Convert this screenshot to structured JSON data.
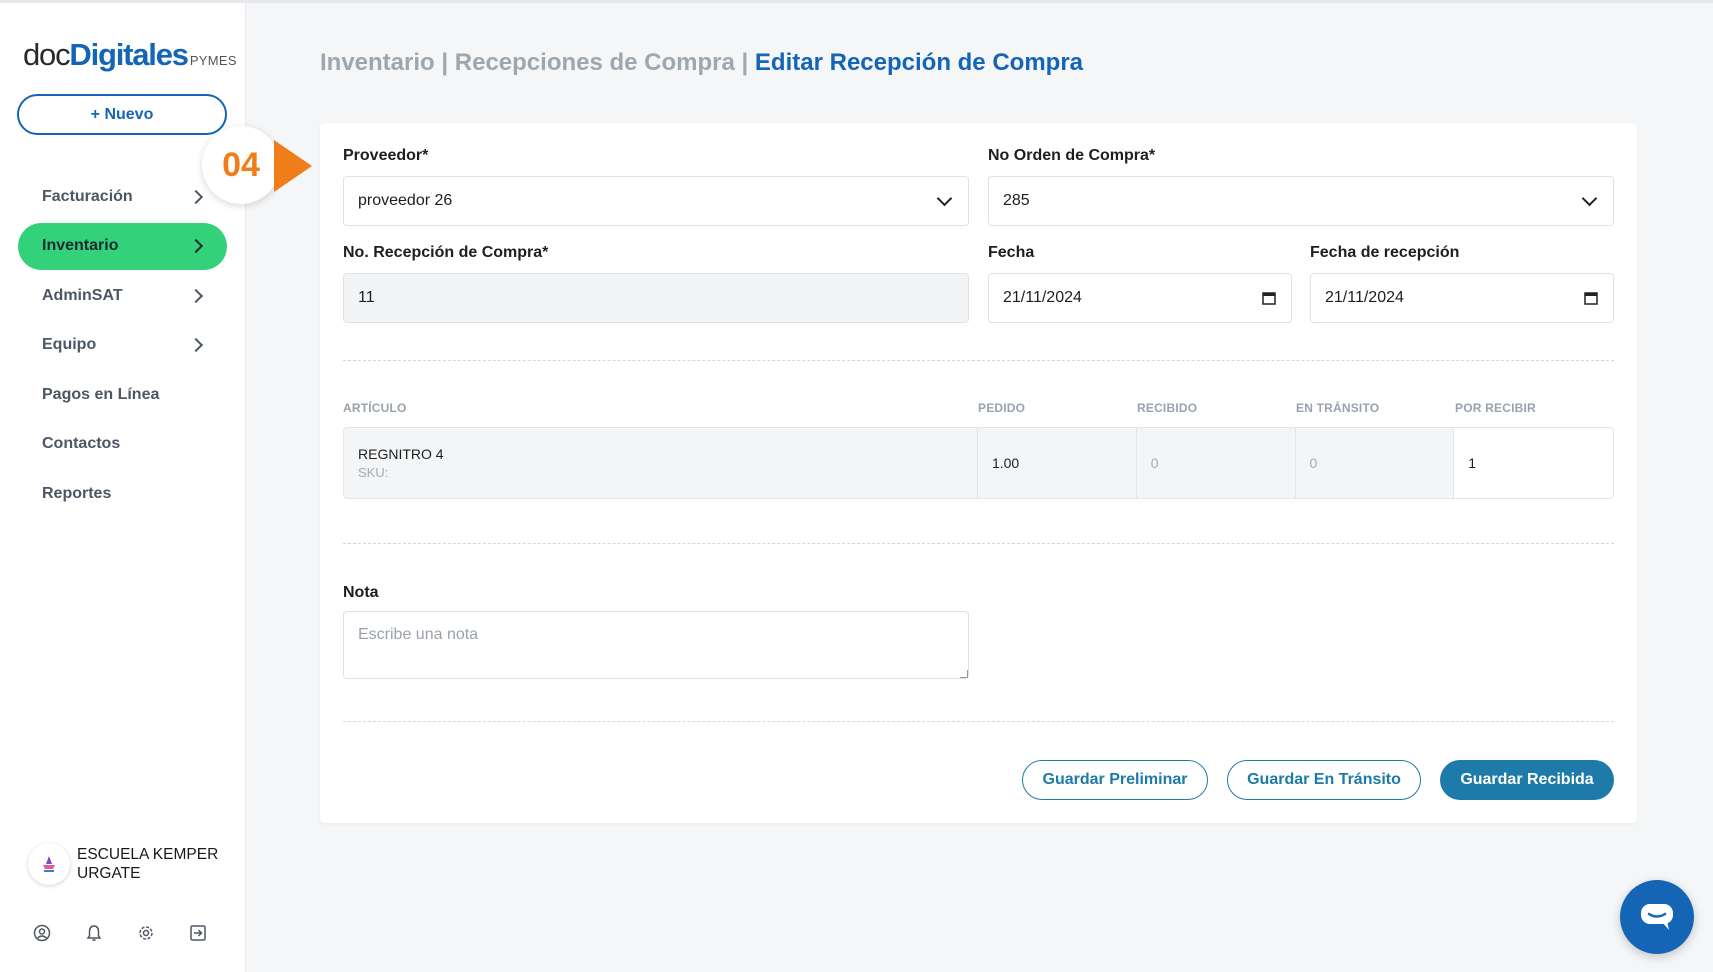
{
  "sidebar": {
    "logo": {
      "part1": "doc",
      "part2": "Digitales",
      "suffix": "PYMES"
    },
    "new_button": "+ Nuevo",
    "items": [
      {
        "label": "Facturación"
      },
      {
        "label": "Inventario"
      },
      {
        "label": "AdminSAT"
      },
      {
        "label": "Equipo"
      },
      {
        "label": "Pagos en Línea"
      },
      {
        "label": "Contactos"
      },
      {
        "label": "Reportes"
      }
    ],
    "user": {
      "name": "ESCUELA KEMPER URGATE"
    }
  },
  "step_marker": "04",
  "breadcrumb": {
    "part1": "Inventario",
    "sep1": " | ",
    "part2": "Recepciones de Compra",
    "sep2": " | ",
    "current": "Editar Recepción de Compra"
  },
  "form": {
    "proveedor": {
      "label": "Proveedor*",
      "value": "proveedor 26"
    },
    "orden": {
      "label": "No Orden de Compra*",
      "value": "285"
    },
    "recepcion": {
      "label": "No. Recepción de Compra*",
      "value": "11"
    },
    "fecha": {
      "label": "Fecha",
      "value": "21/11/2024"
    },
    "fecha_recepcion": {
      "label": "Fecha de recepción",
      "value": "21/11/2024"
    }
  },
  "table": {
    "headers": {
      "articulo": "Artículo",
      "pedido": "Pedido",
      "recibido": "Recibido",
      "transito": "En Tránsito",
      "por_recibir": "Por Recibir"
    },
    "rows": [
      {
        "articulo": "REGNITRO 4",
        "sku": "SKU:",
        "pedido": "1.00",
        "recibido": "0",
        "transito": "0",
        "por_recibir": "1"
      }
    ]
  },
  "nota": {
    "label": "Nota",
    "placeholder": "Escribe una nota"
  },
  "buttons": {
    "preliminar": "Guardar Preliminar",
    "transito": "Guardar En Tránsito",
    "recibida": "Guardar Recibida"
  },
  "colors": {
    "brand_blue": "#1565b6",
    "active_green": "#33d17a",
    "button_teal": "#1e7aa8",
    "step_orange": "#ef7d1a"
  }
}
